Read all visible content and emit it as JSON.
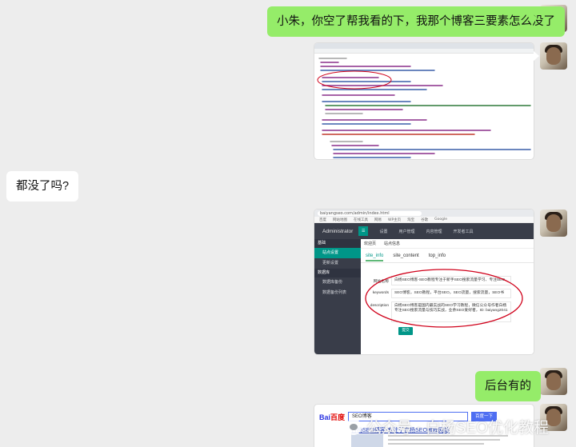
{
  "messages": {
    "m1": "小朱，你空了帮我看的下，我那个博客三要素怎么没了",
    "m2": "都没了吗?",
    "m3": "后台有的"
  },
  "admin_shot": {
    "url": "baiyangseo.com/admin/index.html",
    "bookmarks": [
      "百度",
      "网站地图",
      "在线工具",
      "网易",
      "WP主页",
      "淘宝",
      "谷歌",
      "Google"
    ],
    "brand": "Administrator",
    "nav": [
      "设置",
      "用户管理",
      "内容管理",
      "开发者工具"
    ],
    "sidebar": {
      "group1": "基础",
      "items1": [
        "站点设置",
        "更新设置"
      ],
      "group2": "数据库",
      "items2": [
        "数据库备份",
        "数据备份列表"
      ]
    },
    "crumbs": [
      "欢迎页",
      "站点信息"
    ],
    "tabs": [
      "site_info",
      "site_content",
      "top_info"
    ],
    "fields": [
      {
        "label": "网站名称",
        "value": "白杨SEO博客-SEO教程专注于新手SEO搜索流量学习、专注SEO"
      },
      {
        "label": "keywords",
        "value": "SEO博客，SEO教程，平台SEO，SEO流量，搜索流量，SEO书"
      },
      {
        "label": "description",
        "value": "白杨SEO博客是国内最实战的SEO学习教程，微信公众号作者白杨专注SEO搜索流量与技巧实战，业余SEO爱好者，ID: baiyang2041"
      }
    ],
    "submit": "提交"
  },
  "baidu_shot": {
    "logo_a": "Bai",
    "logo_b": "百度",
    "query": "SEO博客",
    "button": "百度一下",
    "result_title": "白杨SEO博客-专注于白杨SEO教程网站"
  },
  "watermark": "公众号 · 白杨SEO优化教程"
}
